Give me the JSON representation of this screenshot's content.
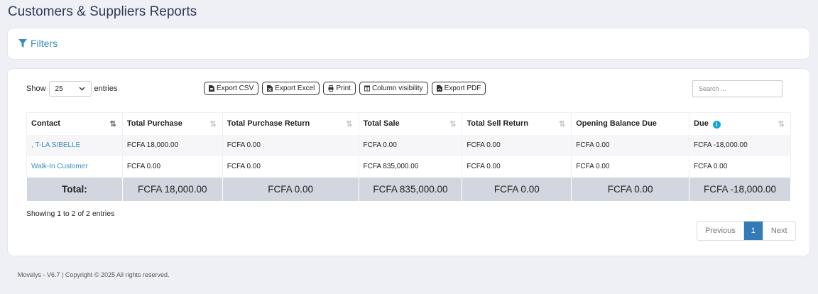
{
  "page": {
    "title": "Customers & Suppliers Reports"
  },
  "filters": {
    "label": "Filters"
  },
  "table_controls": {
    "show_label": "Show",
    "entries_label": "entries",
    "length_value": "25",
    "buttons": [
      {
        "label": "Export CSV",
        "icon": "file-csv-icon"
      },
      {
        "label": "Export Excel",
        "icon": "file-excel-icon"
      },
      {
        "label": "Print",
        "icon": "print-icon"
      },
      {
        "label": "Column visibility",
        "icon": "columns-icon"
      },
      {
        "label": "Export PDF",
        "icon": "file-pdf-icon"
      }
    ],
    "search_placeholder": "Search ..."
  },
  "table": {
    "columns": [
      "Contact",
      "Total Purchase",
      "Total Purchase Return",
      "Total Sale",
      "Total Sell Return",
      "Opening Balance Due",
      "Due"
    ],
    "rows": [
      [
        ", T-LA SIBELLE",
        "FCFA 18,000.00",
        "FCFA 0.00",
        "FCFA 0.00",
        "FCFA 0.00",
        "FCFA 0.00",
        "FCFA -18,000.00"
      ],
      [
        "Walk-In Customer",
        "FCFA 0.00",
        "FCFA 0.00",
        "FCFA 835,000.00",
        "FCFA 0.00",
        "FCFA 0.00",
        "FCFA 0.00"
      ]
    ],
    "totals": [
      "Total:",
      "FCFA 18,000.00",
      "FCFA 0.00",
      "FCFA 835,000.00",
      "FCFA 0.00",
      "FCFA 0.00",
      "FCFA -18,000.00"
    ]
  },
  "info": "Showing 1 to 2 of 2 entries",
  "pagination": {
    "previous": "Previous",
    "current": "1",
    "next": "Next"
  },
  "footer": "Movelys - V6.7 | Copyright © 2025 All rights reserved.",
  "colors": {
    "link": "#3c8dbc",
    "page_current": "#337ab7",
    "total_row": "#d2d6de",
    "info_icon": "#17a2d8"
  }
}
